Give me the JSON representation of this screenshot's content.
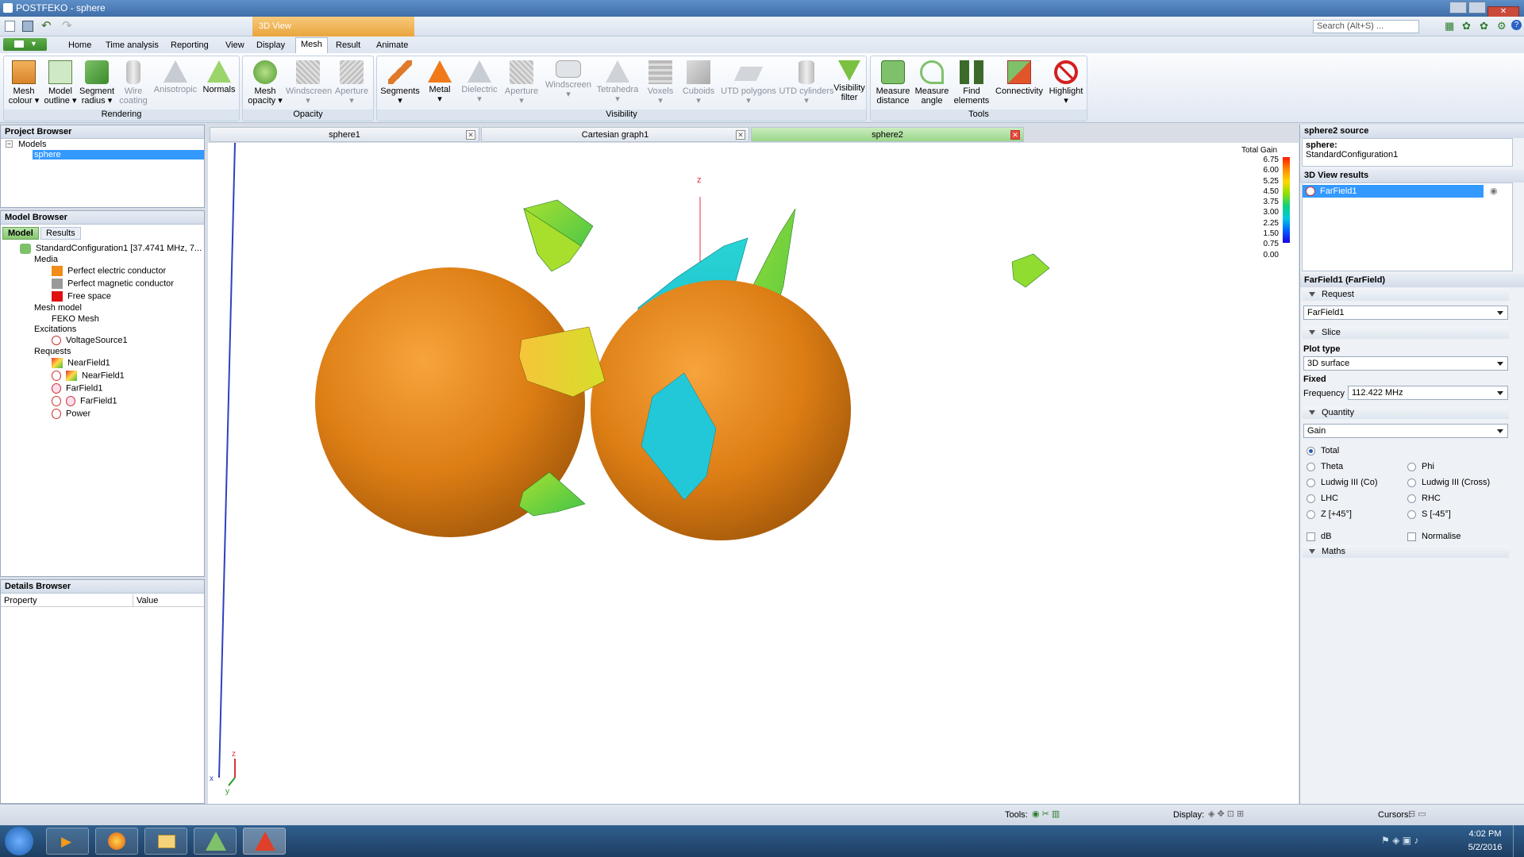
{
  "window": {
    "title": "POSTFEKO - sphere",
    "context_tab": "3D View",
    "search_placeholder": "Search (Alt+S) ..."
  },
  "ribbon_tabs": [
    "Home",
    "Time analysis",
    "Reporting",
    "View",
    "Display",
    "Mesh",
    "Result",
    "Animate"
  ],
  "active_tab": "Mesh",
  "ribbon": {
    "groups": {
      "rendering": "Rendering",
      "opacity": "Opacity",
      "visibility": "Visibility",
      "tools": "Tools"
    },
    "buttons": [
      {
        "l1": "Mesh",
        "l2": "colour"
      },
      {
        "l1": "Model",
        "l2": "outline"
      },
      {
        "l1": "Segment",
        "l2": "radius"
      },
      {
        "l1": "Wire",
        "l2": "coating"
      },
      {
        "l1": "Anisotropic",
        "l2": ""
      },
      {
        "l1": "Normals",
        "l2": ""
      },
      {
        "l1": "Mesh",
        "l2": "opacity"
      },
      {
        "l1": "Windscreen",
        "l2": ""
      },
      {
        "l1": "Aperture",
        "l2": ""
      },
      {
        "l1": "Segments",
        "l2": ""
      },
      {
        "l1": "Metal",
        "l2": ""
      },
      {
        "l1": "Dielectric",
        "l2": ""
      },
      {
        "l1": "Aperture",
        "l2": ""
      },
      {
        "l1": "Windscreen",
        "l2": ""
      },
      {
        "l1": "Tetrahedra",
        "l2": ""
      },
      {
        "l1": "Voxels",
        "l2": ""
      },
      {
        "l1": "Cuboids",
        "l2": ""
      },
      {
        "l1": "UTD polygons",
        "l2": ""
      },
      {
        "l1": "UTD cylinders",
        "l2": ""
      },
      {
        "l1": "Visibility",
        "l2": "filter"
      },
      {
        "l1": "Measure",
        "l2": "distance"
      },
      {
        "l1": "Measure",
        "l2": "angle"
      },
      {
        "l1": "Find",
        "l2": "elements"
      },
      {
        "l1": "Connectivity",
        "l2": ""
      },
      {
        "l1": "Highlight",
        "l2": ""
      }
    ]
  },
  "project_browser": {
    "title": "Project Browser",
    "root": "Models",
    "selected": "sphere"
  },
  "model_browser": {
    "title": "Model Browser",
    "tabs": [
      "Model",
      "Results"
    ],
    "config": "StandardConfiguration1 [37.4741 MHz, 7...",
    "media": "Media",
    "media_items": [
      "Perfect electric conductor",
      "Perfect magnetic conductor",
      "Free space"
    ],
    "media_colors": [
      "#f08c1a",
      "#9a9a9a",
      "#e01010"
    ],
    "mesh_model": "Mesh model",
    "mesh": "FEKO Mesh",
    "excitations": "Excitations",
    "source": "VoltageSource1",
    "requests": "Requests",
    "request_items": [
      "NearField1",
      "NearField1",
      "FarField1",
      "FarField1",
      "Power"
    ]
  },
  "details_browser": {
    "title": "Details Browser",
    "col_property": "Property",
    "col_value": "Value"
  },
  "doc_tabs": [
    "sphere1",
    "Cartesian graph1",
    "sphere2"
  ],
  "viewport": {
    "axis_labels": {
      "z": "z",
      "x": "x",
      "y": "y"
    },
    "legend_title": "Total Gain",
    "legend_values": [
      "6.75",
      "6.00",
      "5.25",
      "4.50",
      "3.75",
      "3.00",
      "2.25",
      "1.50",
      "0.75",
      "0.00"
    ]
  },
  "right_panel": {
    "source_title": "sphere2 source",
    "source_label": "sphere:",
    "source_value": "StandardConfiguration1",
    "results_title": "3D View results",
    "result_item": "FarField1",
    "props_title": "FarField1 (FarField)",
    "request_section": "Request",
    "request_value": "FarField1",
    "slice_section": "Slice",
    "plot_type_label": "Plot type",
    "plot_type_value": "3D surface",
    "fixed_label": "Fixed",
    "frequency_label": "Frequency",
    "frequency_value": "112.422 MHz",
    "quantity_section": "Quantity",
    "quantity_value": "Gain",
    "components": [
      "Total",
      "Theta",
      "Phi",
      "Ludwig III (Co)",
      "Ludwig III (Cross)",
      "LHC",
      "RHC",
      "Z [+45°]",
      "S [-45°]"
    ],
    "selected_component": "Total",
    "db_label": "dB",
    "normalise_label": "Normalise",
    "maths_section": "Maths"
  },
  "statusbar": {
    "tools": "Tools:",
    "display": "Display:",
    "cursors": "Cursors:"
  },
  "taskbar": {
    "time": "4:02 PM",
    "date": "5/2/2016"
  }
}
